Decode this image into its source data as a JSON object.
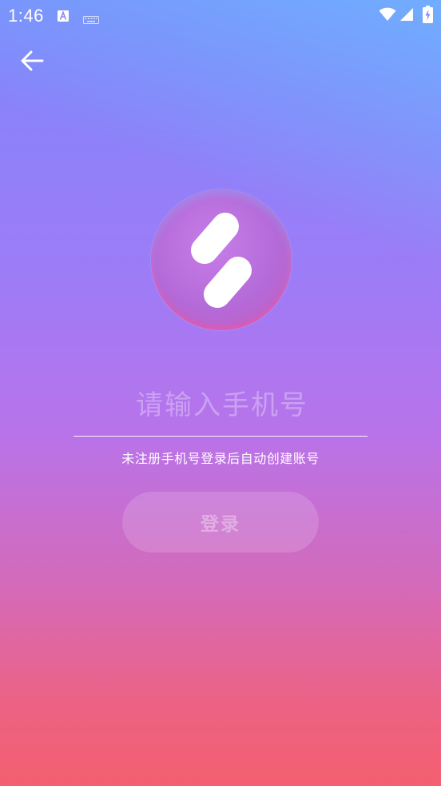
{
  "status_bar": {
    "time": "1:46",
    "icons": [
      "a-notification-icon",
      "keyboard-icon",
      "wifi-icon",
      "cell-signal-icon",
      "battery-charging-icon"
    ]
  },
  "navigation": {
    "back_icon": "arrow-left-icon"
  },
  "logo": {
    "icon": "app-logo-icon"
  },
  "phone_input": {
    "value": "",
    "placeholder": "请输入手机号"
  },
  "hint": "未注册手机号登录后自动创建账号",
  "login_button": {
    "label": "登录"
  },
  "colors": {
    "gradient_top": "#7f86fb",
    "gradient_mid": "#b873ea",
    "gradient_bottom": "#f45f70",
    "text": "#ffffff"
  }
}
